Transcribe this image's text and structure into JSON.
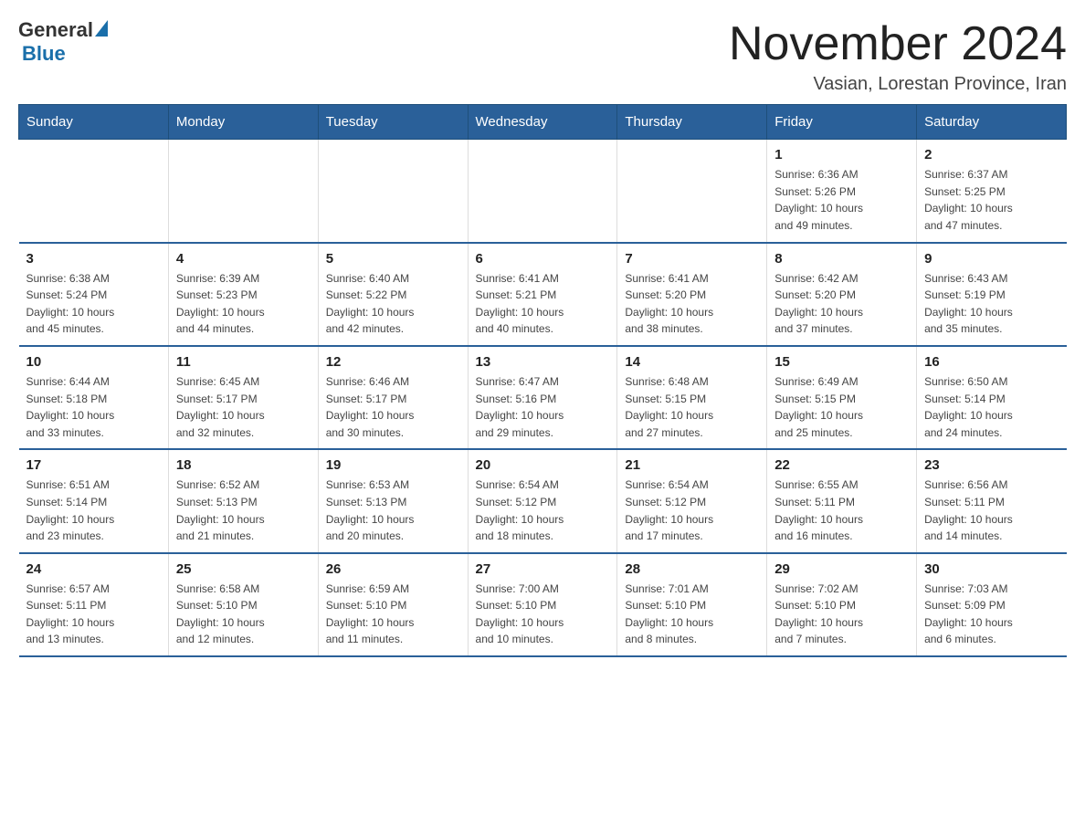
{
  "logo": {
    "general": "General",
    "blue": "Blue"
  },
  "title": "November 2024",
  "location": "Vasian, Lorestan Province, Iran",
  "weekdays": [
    "Sunday",
    "Monday",
    "Tuesday",
    "Wednesday",
    "Thursday",
    "Friday",
    "Saturday"
  ],
  "weeks": [
    [
      {
        "day": "",
        "info": ""
      },
      {
        "day": "",
        "info": ""
      },
      {
        "day": "",
        "info": ""
      },
      {
        "day": "",
        "info": ""
      },
      {
        "day": "",
        "info": ""
      },
      {
        "day": "1",
        "info": "Sunrise: 6:36 AM\nSunset: 5:26 PM\nDaylight: 10 hours\nand 49 minutes."
      },
      {
        "day": "2",
        "info": "Sunrise: 6:37 AM\nSunset: 5:25 PM\nDaylight: 10 hours\nand 47 minutes."
      }
    ],
    [
      {
        "day": "3",
        "info": "Sunrise: 6:38 AM\nSunset: 5:24 PM\nDaylight: 10 hours\nand 45 minutes."
      },
      {
        "day": "4",
        "info": "Sunrise: 6:39 AM\nSunset: 5:23 PM\nDaylight: 10 hours\nand 44 minutes."
      },
      {
        "day": "5",
        "info": "Sunrise: 6:40 AM\nSunset: 5:22 PM\nDaylight: 10 hours\nand 42 minutes."
      },
      {
        "day": "6",
        "info": "Sunrise: 6:41 AM\nSunset: 5:21 PM\nDaylight: 10 hours\nand 40 minutes."
      },
      {
        "day": "7",
        "info": "Sunrise: 6:41 AM\nSunset: 5:20 PM\nDaylight: 10 hours\nand 38 minutes."
      },
      {
        "day": "8",
        "info": "Sunrise: 6:42 AM\nSunset: 5:20 PM\nDaylight: 10 hours\nand 37 minutes."
      },
      {
        "day": "9",
        "info": "Sunrise: 6:43 AM\nSunset: 5:19 PM\nDaylight: 10 hours\nand 35 minutes."
      }
    ],
    [
      {
        "day": "10",
        "info": "Sunrise: 6:44 AM\nSunset: 5:18 PM\nDaylight: 10 hours\nand 33 minutes."
      },
      {
        "day": "11",
        "info": "Sunrise: 6:45 AM\nSunset: 5:17 PM\nDaylight: 10 hours\nand 32 minutes."
      },
      {
        "day": "12",
        "info": "Sunrise: 6:46 AM\nSunset: 5:17 PM\nDaylight: 10 hours\nand 30 minutes."
      },
      {
        "day": "13",
        "info": "Sunrise: 6:47 AM\nSunset: 5:16 PM\nDaylight: 10 hours\nand 29 minutes."
      },
      {
        "day": "14",
        "info": "Sunrise: 6:48 AM\nSunset: 5:15 PM\nDaylight: 10 hours\nand 27 minutes."
      },
      {
        "day": "15",
        "info": "Sunrise: 6:49 AM\nSunset: 5:15 PM\nDaylight: 10 hours\nand 25 minutes."
      },
      {
        "day": "16",
        "info": "Sunrise: 6:50 AM\nSunset: 5:14 PM\nDaylight: 10 hours\nand 24 minutes."
      }
    ],
    [
      {
        "day": "17",
        "info": "Sunrise: 6:51 AM\nSunset: 5:14 PM\nDaylight: 10 hours\nand 23 minutes."
      },
      {
        "day": "18",
        "info": "Sunrise: 6:52 AM\nSunset: 5:13 PM\nDaylight: 10 hours\nand 21 minutes."
      },
      {
        "day": "19",
        "info": "Sunrise: 6:53 AM\nSunset: 5:13 PM\nDaylight: 10 hours\nand 20 minutes."
      },
      {
        "day": "20",
        "info": "Sunrise: 6:54 AM\nSunset: 5:12 PM\nDaylight: 10 hours\nand 18 minutes."
      },
      {
        "day": "21",
        "info": "Sunrise: 6:54 AM\nSunset: 5:12 PM\nDaylight: 10 hours\nand 17 minutes."
      },
      {
        "day": "22",
        "info": "Sunrise: 6:55 AM\nSunset: 5:11 PM\nDaylight: 10 hours\nand 16 minutes."
      },
      {
        "day": "23",
        "info": "Sunrise: 6:56 AM\nSunset: 5:11 PM\nDaylight: 10 hours\nand 14 minutes."
      }
    ],
    [
      {
        "day": "24",
        "info": "Sunrise: 6:57 AM\nSunset: 5:11 PM\nDaylight: 10 hours\nand 13 minutes."
      },
      {
        "day": "25",
        "info": "Sunrise: 6:58 AM\nSunset: 5:10 PM\nDaylight: 10 hours\nand 12 minutes."
      },
      {
        "day": "26",
        "info": "Sunrise: 6:59 AM\nSunset: 5:10 PM\nDaylight: 10 hours\nand 11 minutes."
      },
      {
        "day": "27",
        "info": "Sunrise: 7:00 AM\nSunset: 5:10 PM\nDaylight: 10 hours\nand 10 minutes."
      },
      {
        "day": "28",
        "info": "Sunrise: 7:01 AM\nSunset: 5:10 PM\nDaylight: 10 hours\nand 8 minutes."
      },
      {
        "day": "29",
        "info": "Sunrise: 7:02 AM\nSunset: 5:10 PM\nDaylight: 10 hours\nand 7 minutes."
      },
      {
        "day": "30",
        "info": "Sunrise: 7:03 AM\nSunset: 5:09 PM\nDaylight: 10 hours\nand 6 minutes."
      }
    ]
  ]
}
